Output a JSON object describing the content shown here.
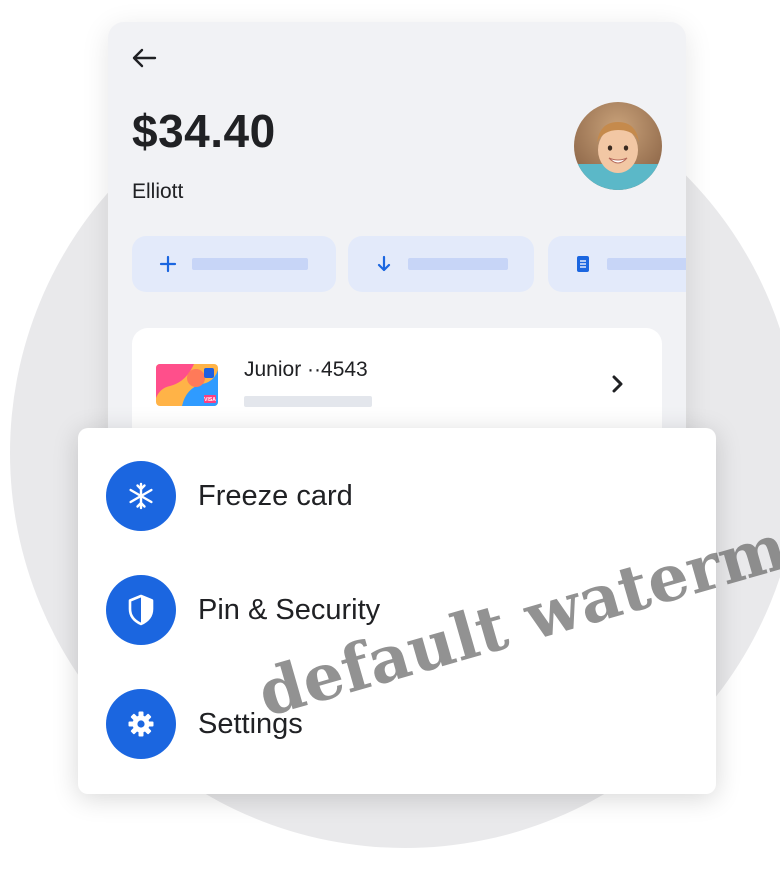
{
  "account": {
    "balance": "$34.40",
    "child_name": "Elliott"
  },
  "card": {
    "title": "Junior ··4543",
    "brand_text": "VISA"
  },
  "menu": {
    "items": [
      {
        "label": "Freeze card",
        "icon": "snowflake-icon"
      },
      {
        "label": "Pin & Security",
        "icon": "shield-icon"
      },
      {
        "label": "Settings",
        "icon": "gear-icon"
      }
    ]
  },
  "quick_actions": [
    {
      "icon": "plus-icon"
    },
    {
      "icon": "download-arrow-icon"
    },
    {
      "icon": "document-icon"
    }
  ],
  "watermark": "default waterma",
  "colors": {
    "accent": "#1b66e0",
    "chip_bg": "#e3eafa",
    "chip_placeholder": "#c7d5f7",
    "screen_bg": "#f1f2f5"
  }
}
